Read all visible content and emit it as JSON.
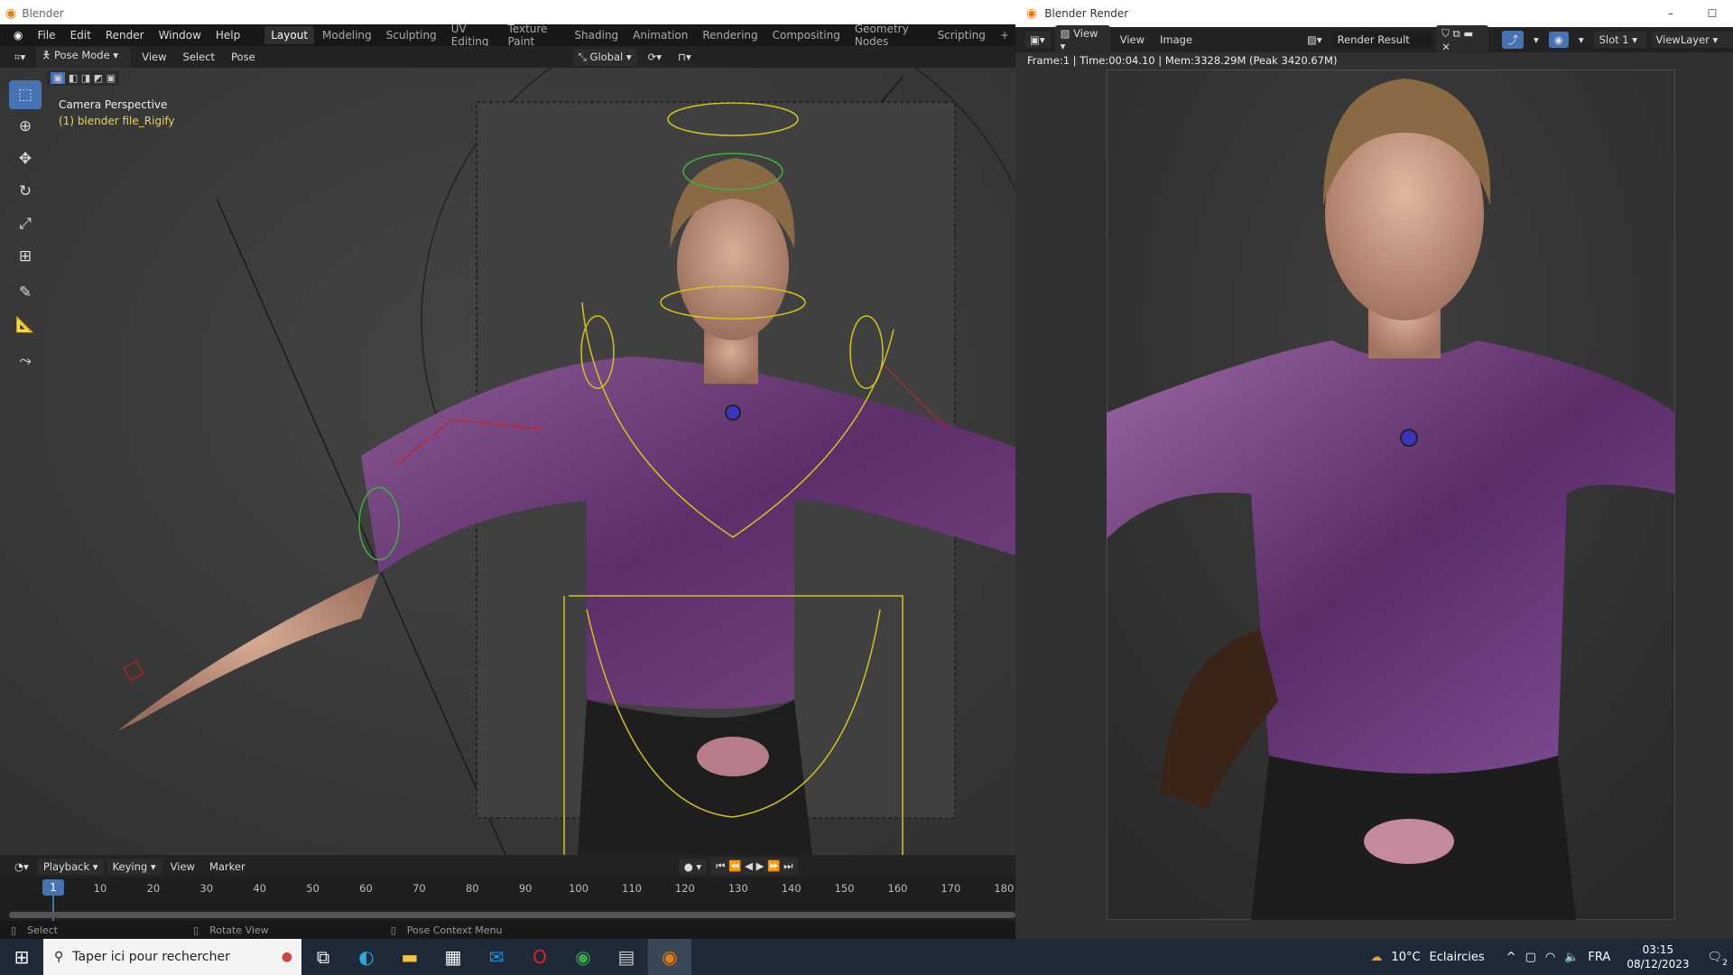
{
  "main_window": {
    "title": "Blender"
  },
  "menu": {
    "items": [
      "File",
      "Edit",
      "Render",
      "Window",
      "Help"
    ],
    "workspaces": [
      "Layout",
      "Modeling",
      "Sculpting",
      "UV Editing",
      "Texture Paint",
      "Shading",
      "Animation",
      "Rendering",
      "Compositing",
      "Geometry Nodes",
      "Scripting"
    ],
    "add": "+"
  },
  "header": {
    "mode": "Pose Mode",
    "menus": [
      "View",
      "Select",
      "Pose"
    ],
    "orientation": "Global"
  },
  "viewport": {
    "view_name": "Camera Perspective",
    "object_name": "(1) blender file_Rigify"
  },
  "timeline": {
    "menus": [
      "Playback",
      "Keying",
      "View",
      "Marker"
    ],
    "current_frame": "1",
    "ticks": [
      "10",
      "20",
      "30",
      "40",
      "50",
      "60",
      "70",
      "80",
      "90",
      "100",
      "110",
      "120",
      "130",
      "140",
      "150",
      "160",
      "170",
      "180"
    ]
  },
  "statusbar": {
    "items": [
      "Select",
      "Rotate View",
      "Pose Context Menu"
    ]
  },
  "render_window": {
    "title": "Blender Render",
    "view_btn": "View",
    "menus": [
      "View",
      "Image"
    ],
    "image_name": "Render Result",
    "slot": "Slot 1",
    "view_layer": "ViewLayer",
    "info": "Frame:1 | Time:00:04.10 | Mem:3328.29M (Peak 3420.67M)",
    "min": "–",
    "max": "☐"
  },
  "taskbar": {
    "search_placeholder": "Taper ici pour rechercher",
    "weather_temp": "10°C",
    "weather_desc": "Eclaircies",
    "lang": "FRA",
    "time": "03:15",
    "date": "08/12/2023",
    "notif_count": "2"
  },
  "colors": {
    "accent": "#4772b3",
    "rig_yellow": "#d4c21a",
    "shirt": "#6a3a78"
  }
}
